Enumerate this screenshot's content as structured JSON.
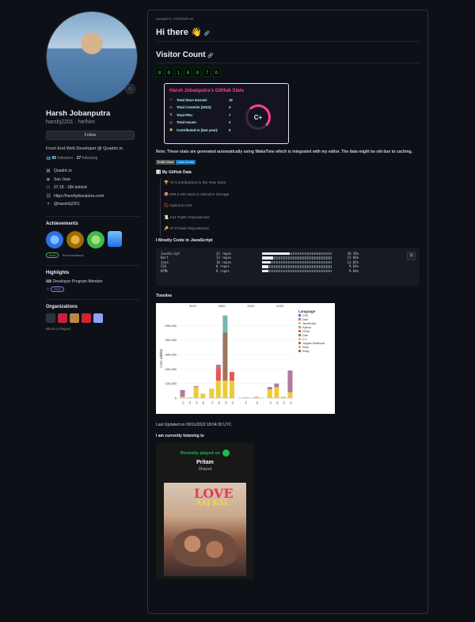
{
  "profile": {
    "name": "Harsh Jobanputra",
    "login": "harshj2201 · he/him",
    "follow_label": "Follow",
    "bio": "Front End Web Developer @ Quadric.io",
    "followers_count": "85",
    "followers_label": "followers",
    "following_count": "27",
    "following_label": "following",
    "details": [
      {
        "icon": "building-icon",
        "glyph": "▦",
        "text": "Quadric.io"
      },
      {
        "icon": "location-icon",
        "glyph": "◉",
        "text": "San Jose"
      },
      {
        "icon": "clock-icon",
        "glyph": "◷",
        "text": "07:18 - 18h behind"
      },
      {
        "icon": "link-icon",
        "glyph": "⛓",
        "text": "https://harshjobanputra.com/"
      },
      {
        "icon": "twitter-icon",
        "glyph": "✦",
        "text": "@harshhj2201"
      }
    ]
  },
  "achievements": {
    "title": "Achievements",
    "badge_count": "x2",
    "beta_label": "Beta",
    "feedback_label": "Send feedback"
  },
  "highlights": {
    "title": "Highlights",
    "item": "Developer Program Member",
    "pro_label": "PRO"
  },
  "organizations": {
    "title": "Organizations",
    "block_label": "Block or Report"
  },
  "readme": {
    "path": "harshj2201 / README.md",
    "heading": "Hi there 👋",
    "visitor_heading": "Visitor Count",
    "counter_digits": [
      "0",
      "0",
      "1",
      "0",
      "0",
      "7",
      "6"
    ]
  },
  "stats_card": {
    "title": "Harsh Jobanputra's GitHub Stats",
    "rows": [
      {
        "label": "Total Stars Earned:",
        "value": "16"
      },
      {
        "label": "Total Commits (2022):",
        "value": "4"
      },
      {
        "label": "Total PRs:",
        "value": "7"
      },
      {
        "label": "Total Issues:",
        "value": "2"
      },
      {
        "label": "Contributed to (last year):",
        "value": "0"
      }
    ],
    "rank": "C+"
  },
  "note": "Note: These stats are generated automatically using WakaTime which is integrated with my editor. The data might be old due to caching.",
  "badges": [
    "Profile Views",
    "Lines of code"
  ],
  "my_github_data": {
    "title": "📊 My GitHub Data",
    "items": [
      "🏆 70 Contributions in the Year 2022",
      "📦 809.2 KB Used in GitHub's Storage",
      "🚫 Opted to Hire",
      "📜 134 Public Repositories",
      "🔑 37 Private Repositories"
    ]
  },
  "languages": {
    "title": "I Mostly Code in JavaScript",
    "rows": [
      {
        "name": "JavaScript",
        "repos": "33 repos",
        "percent": "39.76%",
        "fraction": 0.3976
      },
      {
        "name": "Dart",
        "repos": "13 repos",
        "percent": "15.66%",
        "fraction": 0.1566
      },
      {
        "name": "Java",
        "repos": "10 repos",
        "percent": "12.05%",
        "fraction": 0.1205
      },
      {
        "name": "CSS",
        "repos": "8 repos",
        "percent": "9.64%",
        "fraction": 0.0964
      },
      {
        "name": "HTML",
        "repos": "8 repos",
        "percent": "9.64%",
        "fraction": 0.0964
      }
    ]
  },
  "timeline": {
    "title": "Timeline",
    "chart_data": {
      "type": "bar",
      "stacked": true,
      "ylabel": "LOC added",
      "ylim": [
        0,
        600000
      ],
      "yticks": [
        "0",
        "100,000",
        "200,000",
        "300,000",
        "400,000",
        "500,000"
      ],
      "years": [
        "2019",
        "2020",
        "2021",
        "2022"
      ],
      "legend_title": "Language",
      "legend_position": "right",
      "series": [
        {
          "name": "CSS",
          "color": "#4c78a8"
        },
        {
          "name": "Dart",
          "color": "#b279a2"
        },
        {
          "name": "JavaScript",
          "color": "#eeca3b"
        },
        {
          "name": "Python",
          "color": "#72b7b2"
        },
        {
          "name": "HTML",
          "color": "#e45756"
        },
        {
          "name": "Dart",
          "color": "#54a24b"
        },
        {
          "name": "C++",
          "color": "#ff9da6"
        },
        {
          "name": "Jupyter Notebook",
          "color": "#9d755d"
        },
        {
          "name": "Shell",
          "color": "#bab0ac"
        },
        {
          "name": "Ruby",
          "color": "#79706e"
        }
      ],
      "bars": [
        {
          "year": "2019",
          "stack": [
            [
              10000,
              "#eeca3b"
            ],
            [
              45000,
              "#b279a2"
            ]
          ]
        },
        {
          "year": "2019",
          "stack": [
            [
              5000,
              "#eeca3b"
            ]
          ]
        },
        {
          "year": "2019",
          "stack": [
            [
              75000,
              "#eeca3b"
            ],
            [
              6000,
              "#9d755d"
            ]
          ]
        },
        {
          "year": "2019",
          "stack": [
            [
              30000,
              "#eeca3b"
            ]
          ]
        },
        {
          "year": "2020",
          "stack": [
            [
              65000,
              "#eeca3b"
            ]
          ]
        },
        {
          "year": "2020",
          "stack": [
            [
              120000,
              "#eeca3b"
            ],
            [
              85000,
              "#e45756"
            ],
            [
              25000,
              "#b279a2"
            ]
          ]
        },
        {
          "year": "2020",
          "stack": [
            [
              120000,
              "#eeca3b"
            ],
            [
              330000,
              "#9d755d"
            ],
            [
              120000,
              "#72b7b2"
            ]
          ]
        },
        {
          "year": "2020",
          "stack": [
            [
              120000,
              "#eeca3b"
            ],
            [
              60000,
              "#e45756"
            ]
          ]
        },
        {
          "year": "2021",
          "stack": [
            [
              6000,
              "#eeca3b"
            ]
          ]
        },
        {
          "year": "2021",
          "stack": [
            [
              10000,
              "#eeca3b"
            ]
          ]
        },
        {
          "year": "2022",
          "stack": [
            [
              60000,
              "#eeca3b"
            ],
            [
              16000,
              "#b279a2"
            ]
          ]
        },
        {
          "year": "2022",
          "stack": [
            [
              75000,
              "#eeca3b"
            ],
            [
              25000,
              "#b279a2"
            ]
          ]
        },
        {
          "year": "2022",
          "stack": [
            [
              10000,
              "#eeca3b"
            ]
          ]
        },
        {
          "year": "2022",
          "stack": [
            [
              40000,
              "#eeca3b"
            ],
            [
              150000,
              "#b279a2"
            ]
          ]
        }
      ]
    }
  },
  "last_updated": "Last Updated on 09/11/2022 18:04:30 UTC",
  "listening": "I am currently listening to",
  "spotify": {
    "header": "Recently played on",
    "artist": "Pritam",
    "song": "Shayad",
    "cover_title": "LOVE",
    "cover_subtitle": "AAJ KAL"
  }
}
